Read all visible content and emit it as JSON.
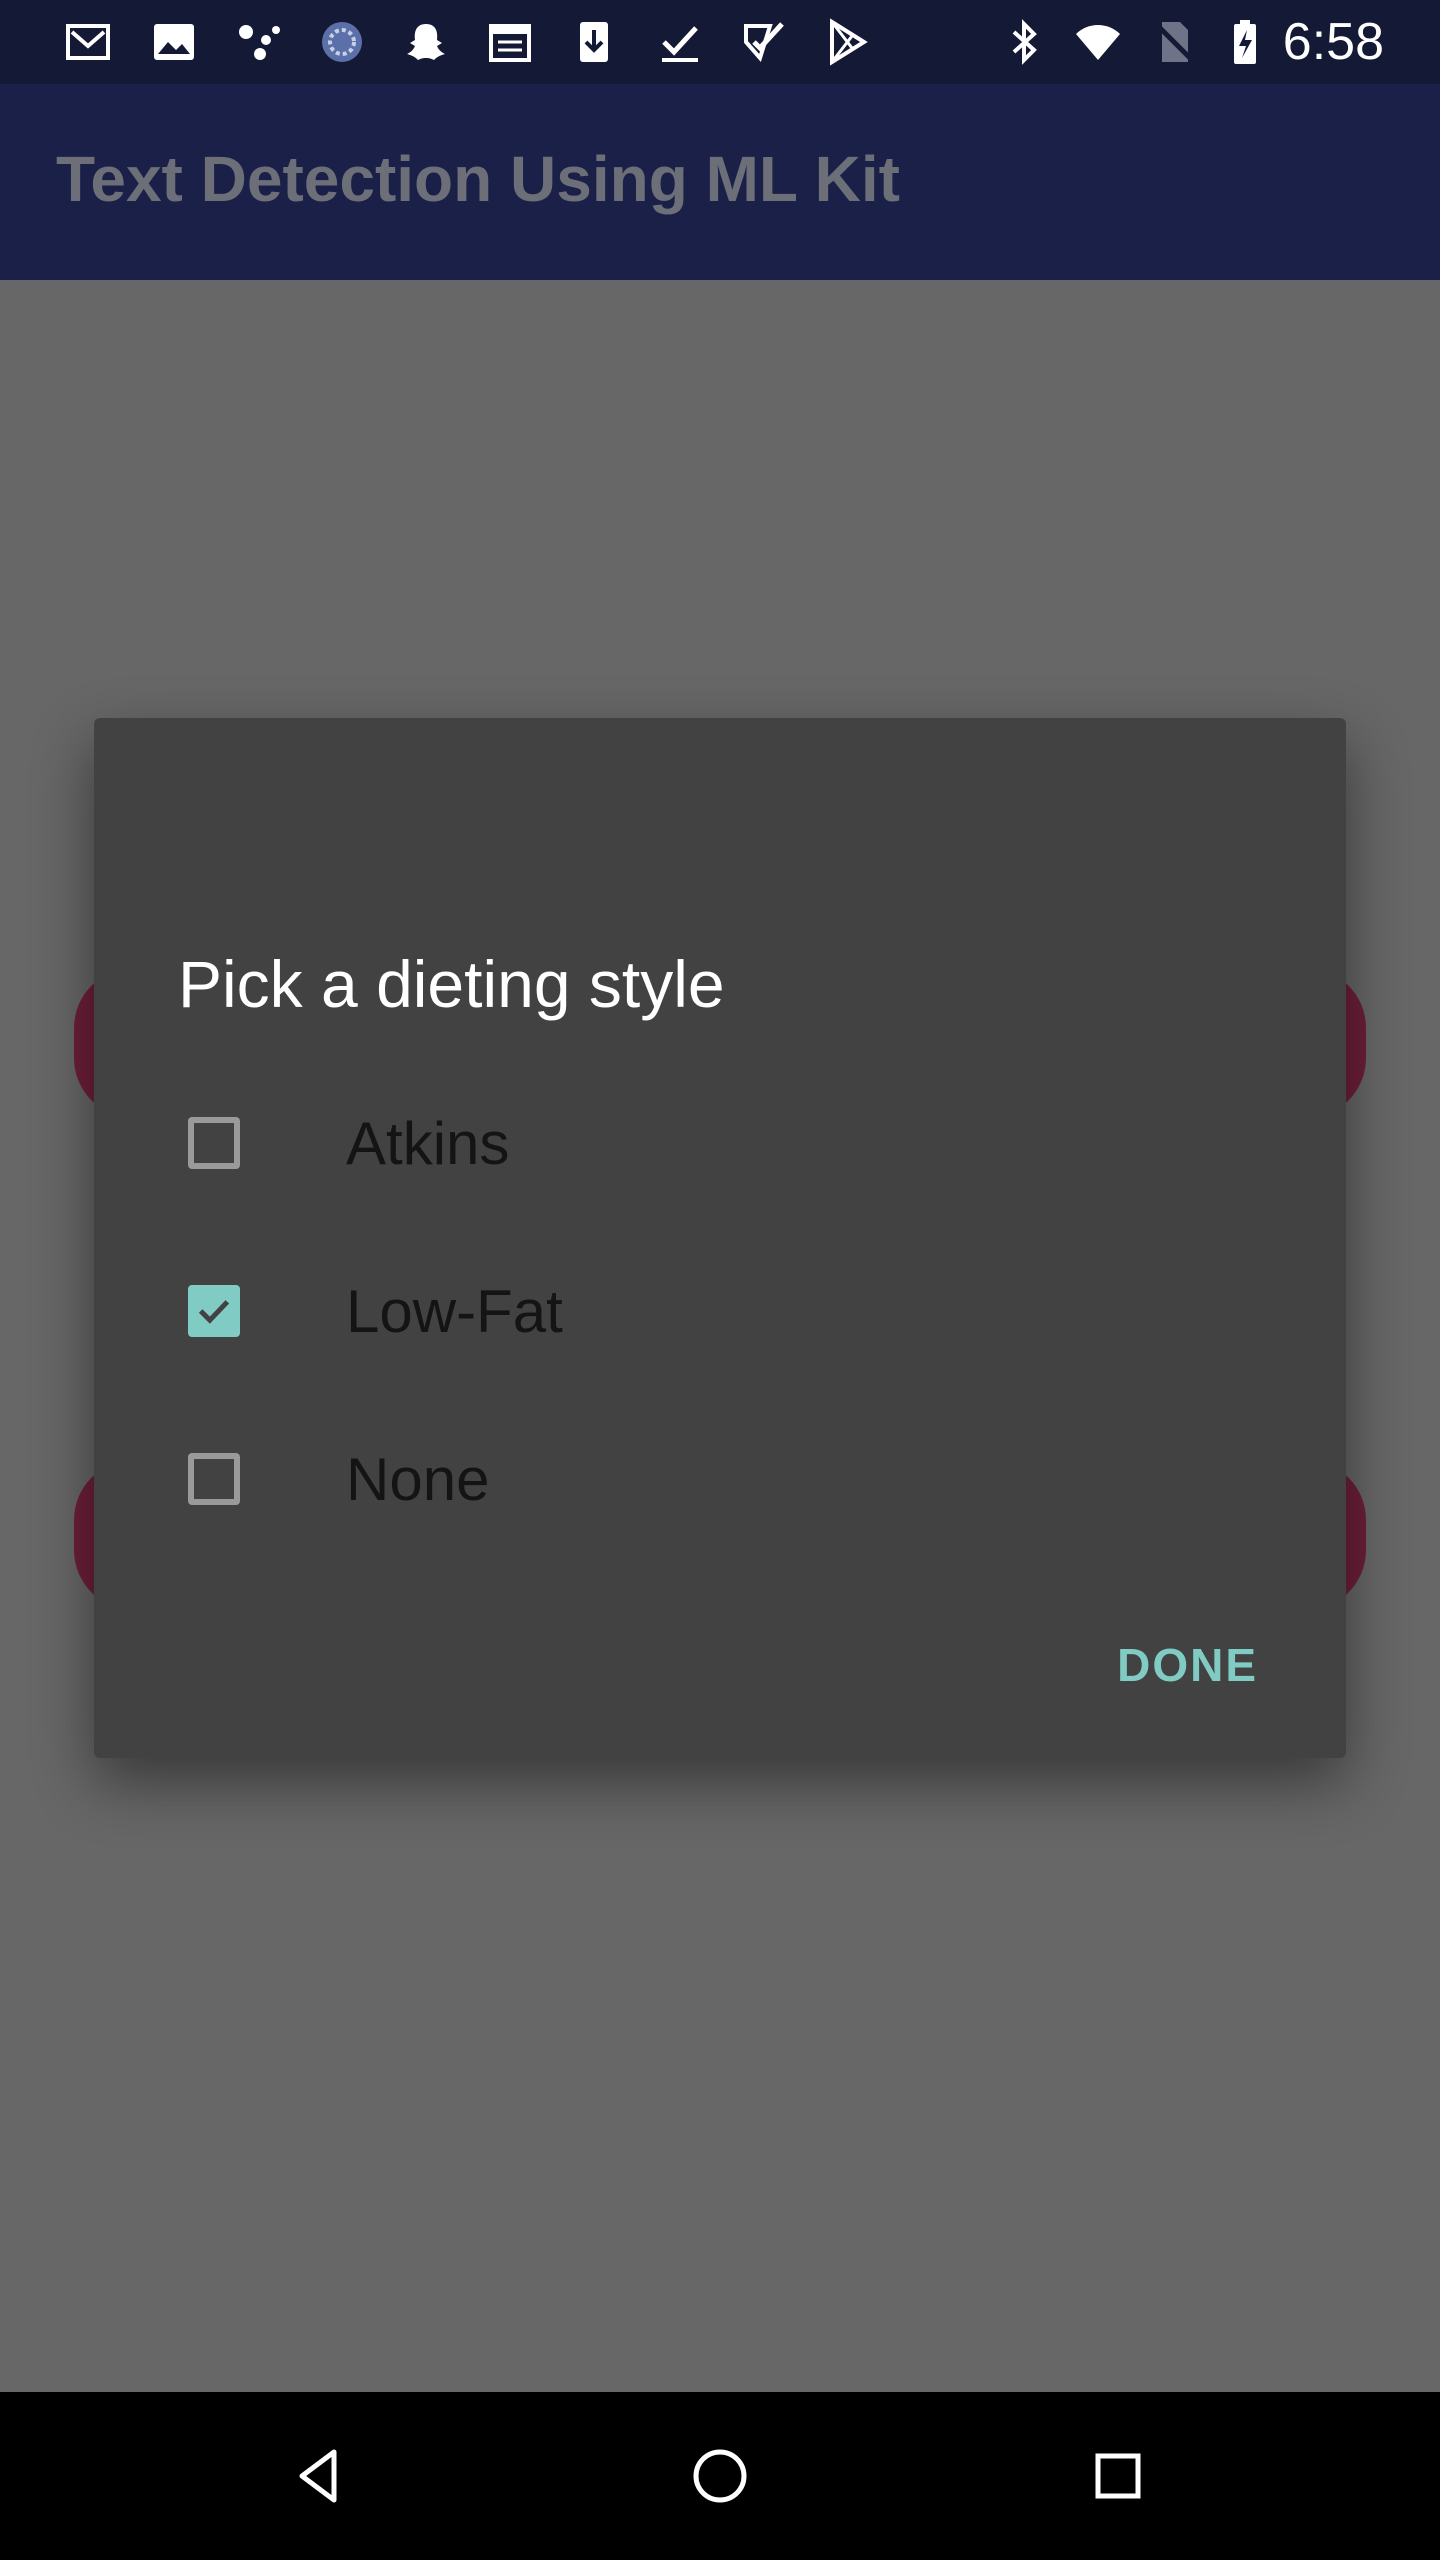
{
  "status_bar": {
    "time": "6:58",
    "icons": [
      "gmail-icon",
      "gallery-icon",
      "assistant-icon",
      "loader-icon",
      "snapchat-icon",
      "calendar-icon",
      "download-icon",
      "check-icon",
      "tasks-icon",
      "play-store-icon",
      "bluetooth-icon",
      "wifi-icon",
      "no-sim-icon",
      "battery-icon"
    ]
  },
  "app_bar": {
    "title": "Text Detection Using ML Kit"
  },
  "dialog": {
    "title": "Pick a dieting style",
    "options": [
      {
        "label": "Atkins",
        "checked": false
      },
      {
        "label": "Low-Fat",
        "checked": true
      },
      {
        "label": "None",
        "checked": false
      }
    ],
    "done_label": "DONE"
  },
  "nav_bar": {
    "buttons": [
      "back-icon",
      "home-icon",
      "recents-icon"
    ]
  },
  "colors": {
    "accent": "#80cbc4",
    "app_bar": "#1b2048",
    "status_bar": "#141a35",
    "scrim_background": "#676767",
    "dialog_background": "#424242"
  }
}
